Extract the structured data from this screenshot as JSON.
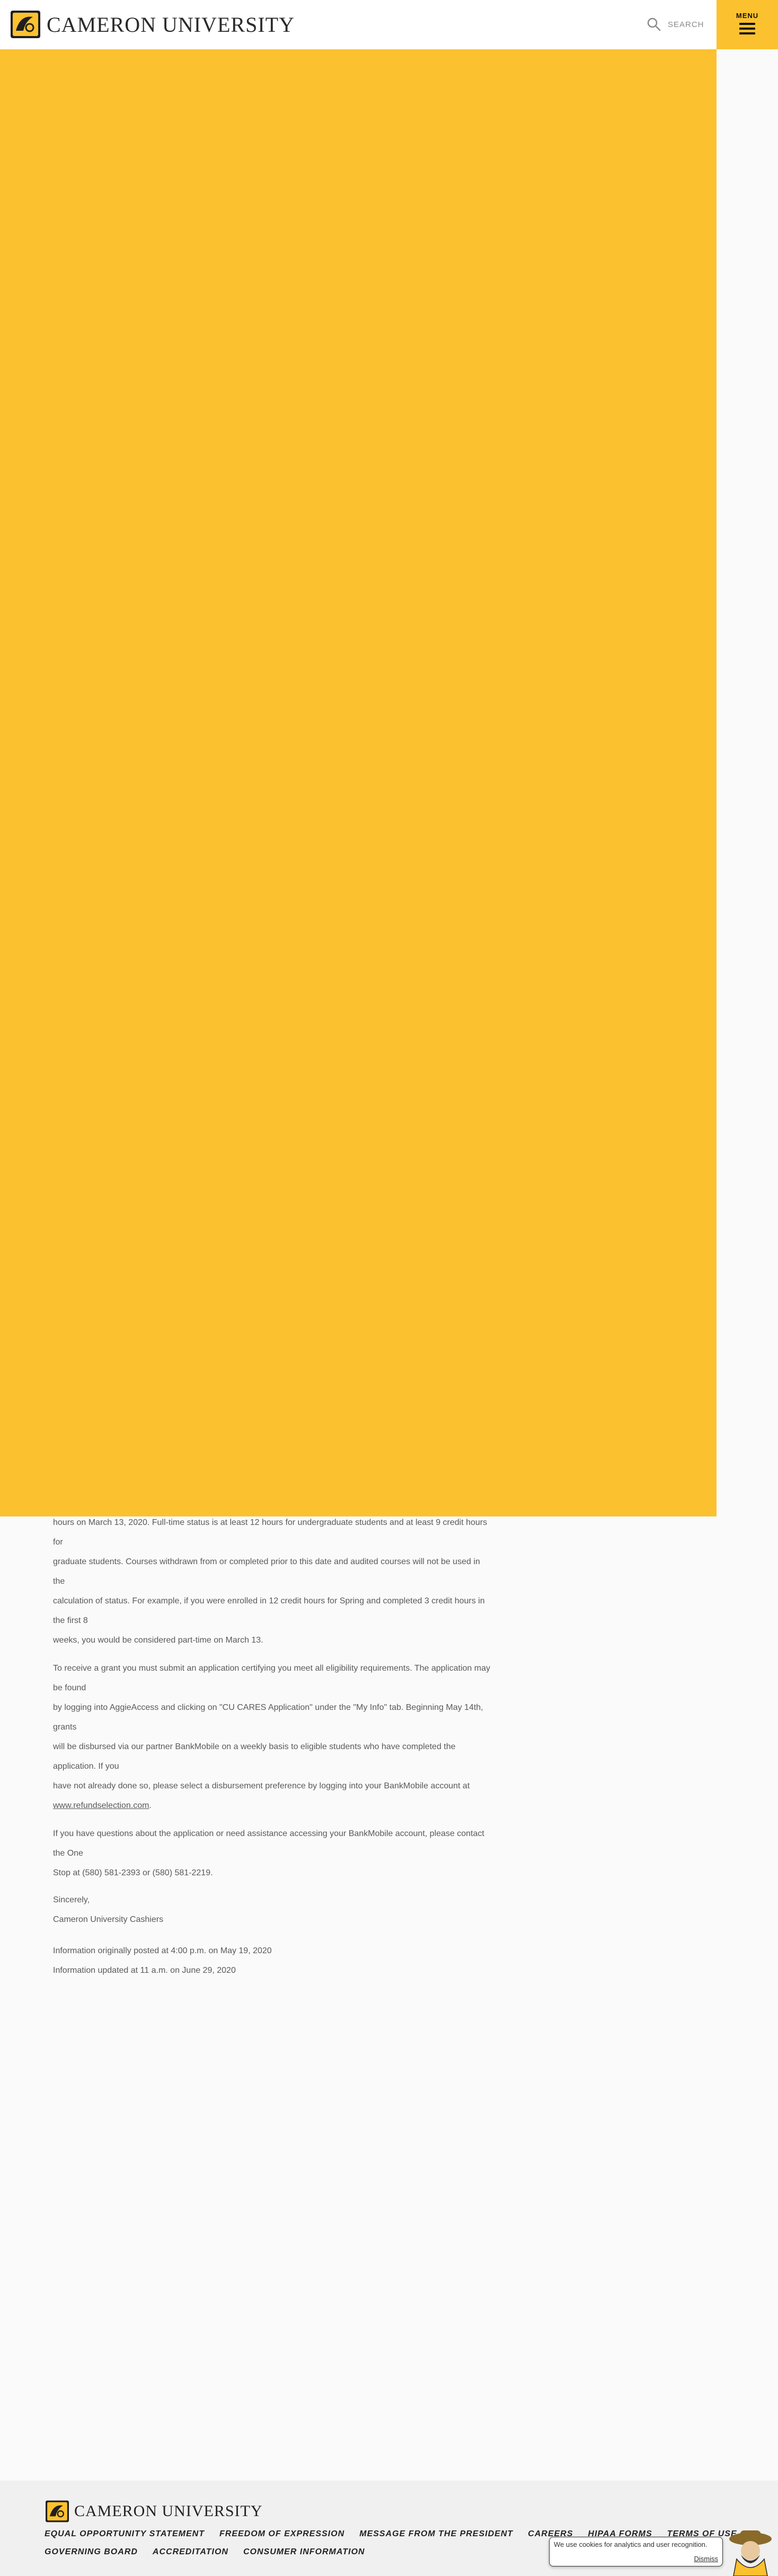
{
  "header": {
    "logo_text": "CAMERON UNIVERSITY",
    "search_label": "SEARCH",
    "menu_label": "MENU"
  },
  "colors": {
    "brand_gold": "#fcc12f",
    "text_gray": "#5a5a5a",
    "footer_bg": "#f0f0f0"
  },
  "article": {
    "p1_lines": [
      "hours on March 13, 2020. Full-time status is at least 12 hours for undergraduate students and at least 9 credit hours for",
      "graduate students. Courses withdrawn from or completed prior to this date and audited courses will not be used in the",
      "calculation of status. For example, if you were enrolled in 12 credit hours for Spring and completed 3 credit hours in the first 8",
      "weeks, you would be considered part-time on March 13."
    ],
    "p2_lines": [
      "To receive a grant you must submit an application certifying you meet all eligibility requirements. The application may be found",
      "by logging into AggieAccess and clicking on \"CU CARES Application\" under the \"My Info\" tab. Beginning May 14th, grants",
      "will be disbursed via our partner BankMobile on a weekly basis to eligible students who have completed the application. If you",
      "have not already done so, please select a disbursement preference by logging into your BankMobile account at"
    ],
    "p2_link": "www.refundselection.com",
    "p2_link_tail": ".",
    "p3_lines": [
      "If you have questions about the application or need assistance accessing your BankMobile account, please contact the One",
      "Stop at (580) 581-2393 or (580) 581-2219."
    ],
    "sincerely": "Sincerely,",
    "signature": "Cameron University Cashiers",
    "posted": "Information originally posted at 4:00 p.m. on May 19, 2020",
    "updated": "Information updated at 11 a.m. on June 29, 2020"
  },
  "footer": {
    "logo_text": "CAMERON UNIVERSITY",
    "links_row1": [
      "EQUAL OPPORTUNITY STATEMENT",
      "FREEDOM OF EXPRESSION",
      "MESSAGE FROM THE PRESIDENT",
      "CAREERS",
      "HIPAA FORMS",
      "TERMS OF USE"
    ],
    "links_row2": [
      "GOVERNING BOARD",
      "ACCREDITATION",
      "CONSUMER INFORMATION"
    ],
    "social_icons": [
      "instagram-icon",
      "facebook-icon",
      "twitter-icon"
    ]
  },
  "cookie": {
    "text": "We use cookies for analytics and user recognition.",
    "dismiss": "Dismiss"
  }
}
